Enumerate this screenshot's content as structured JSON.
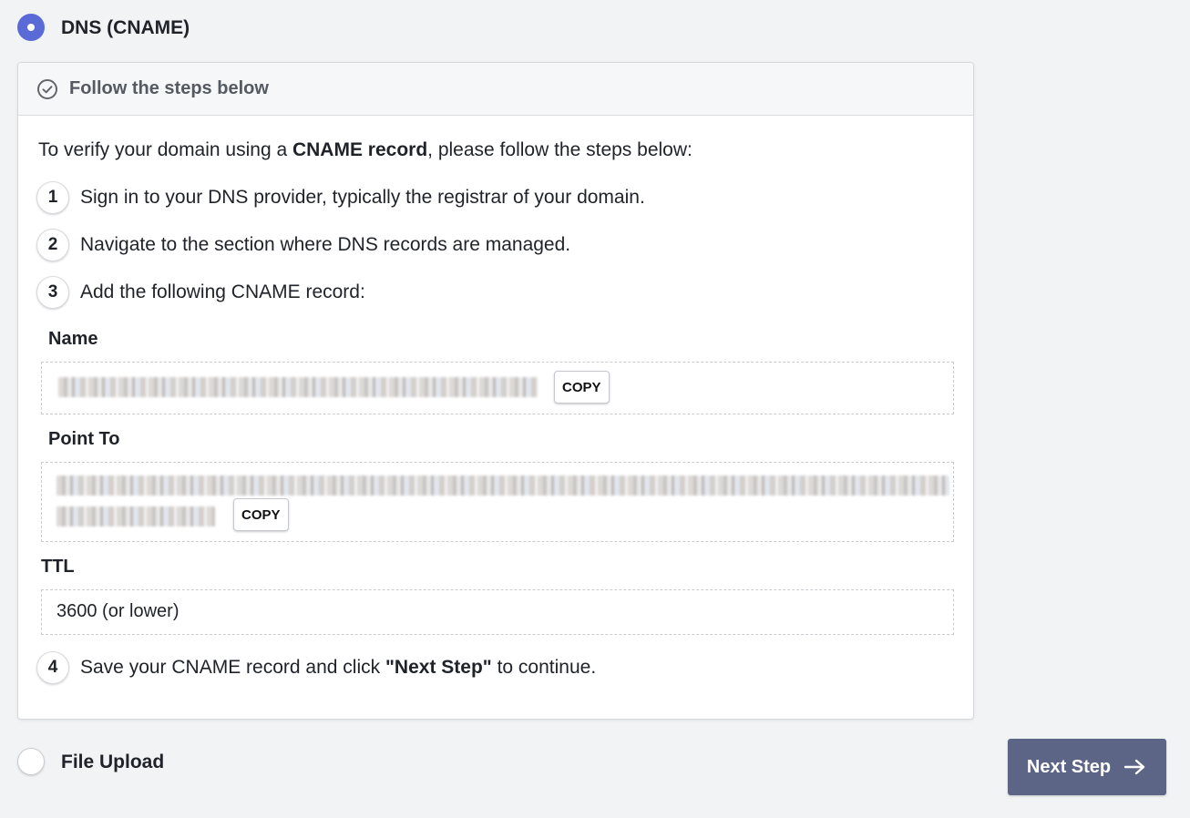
{
  "options": [
    {
      "label": "DNS (CNAME)",
      "selected": true
    },
    {
      "label": "File Upload",
      "selected": false
    }
  ],
  "panel": {
    "header_icon": "check-circle-icon",
    "header_title": "Follow the steps below",
    "intro_prefix": "To verify your domain using a ",
    "intro_bold": "CNAME record",
    "intro_suffix": ", please follow the steps below:",
    "steps": [
      {
        "num": "1",
        "text": "Sign in to your DNS provider, typically the registrar of your domain."
      },
      {
        "num": "2",
        "text": "Navigate to the section where DNS records are managed."
      },
      {
        "num": "3",
        "text": "Add the following CNAME record:"
      },
      {
        "num": "4",
        "text_prefix": "Save your CNAME record and click ",
        "text_bold": "\"Next Step\"",
        "text_suffix": " to continue."
      }
    ],
    "fields": {
      "name_label": "Name",
      "point_to_label": "Point To",
      "ttl_label": "TTL",
      "ttl_value": "3600 (or lower)",
      "copy_label": "COPY"
    }
  },
  "next_button": {
    "label": "Next Step",
    "icon": "arrow-right-icon"
  },
  "colors": {
    "accent": "#5a6bd8",
    "button": "#5c6585",
    "background": "#f2f3f5"
  }
}
